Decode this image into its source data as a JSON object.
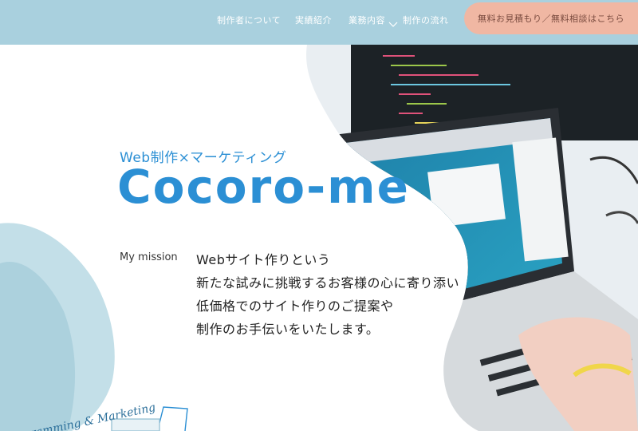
{
  "nav": {
    "items": [
      "制作者について",
      "実績紹介",
      "業務内容",
      "制作の流れ"
    ],
    "cta_label": "無料お見積もり／無料相談はこちら"
  },
  "hero": {
    "eyebrow": "Web制作×マーケティング",
    "brand": "Cocoro-me",
    "mission_label": "My mission",
    "mission_lines": [
      "Webサイト作りという",
      "新たな試みに挑戦するお客様の心に寄り添い",
      "低価格でのサイト作りのご提案や",
      "制作のお手伝いをいたします。"
    ],
    "decorative_script": "Programming & Marketing"
  },
  "colors": {
    "header_bg": "#a9d0de",
    "cta_bg": "#f0b7a3",
    "accent_blue": "#2b8fd4",
    "blob_light": "#b9d9e4"
  },
  "icons": [
    "scroll-down-icon",
    "laptop-photo",
    "coffee-cup-sketch"
  ]
}
